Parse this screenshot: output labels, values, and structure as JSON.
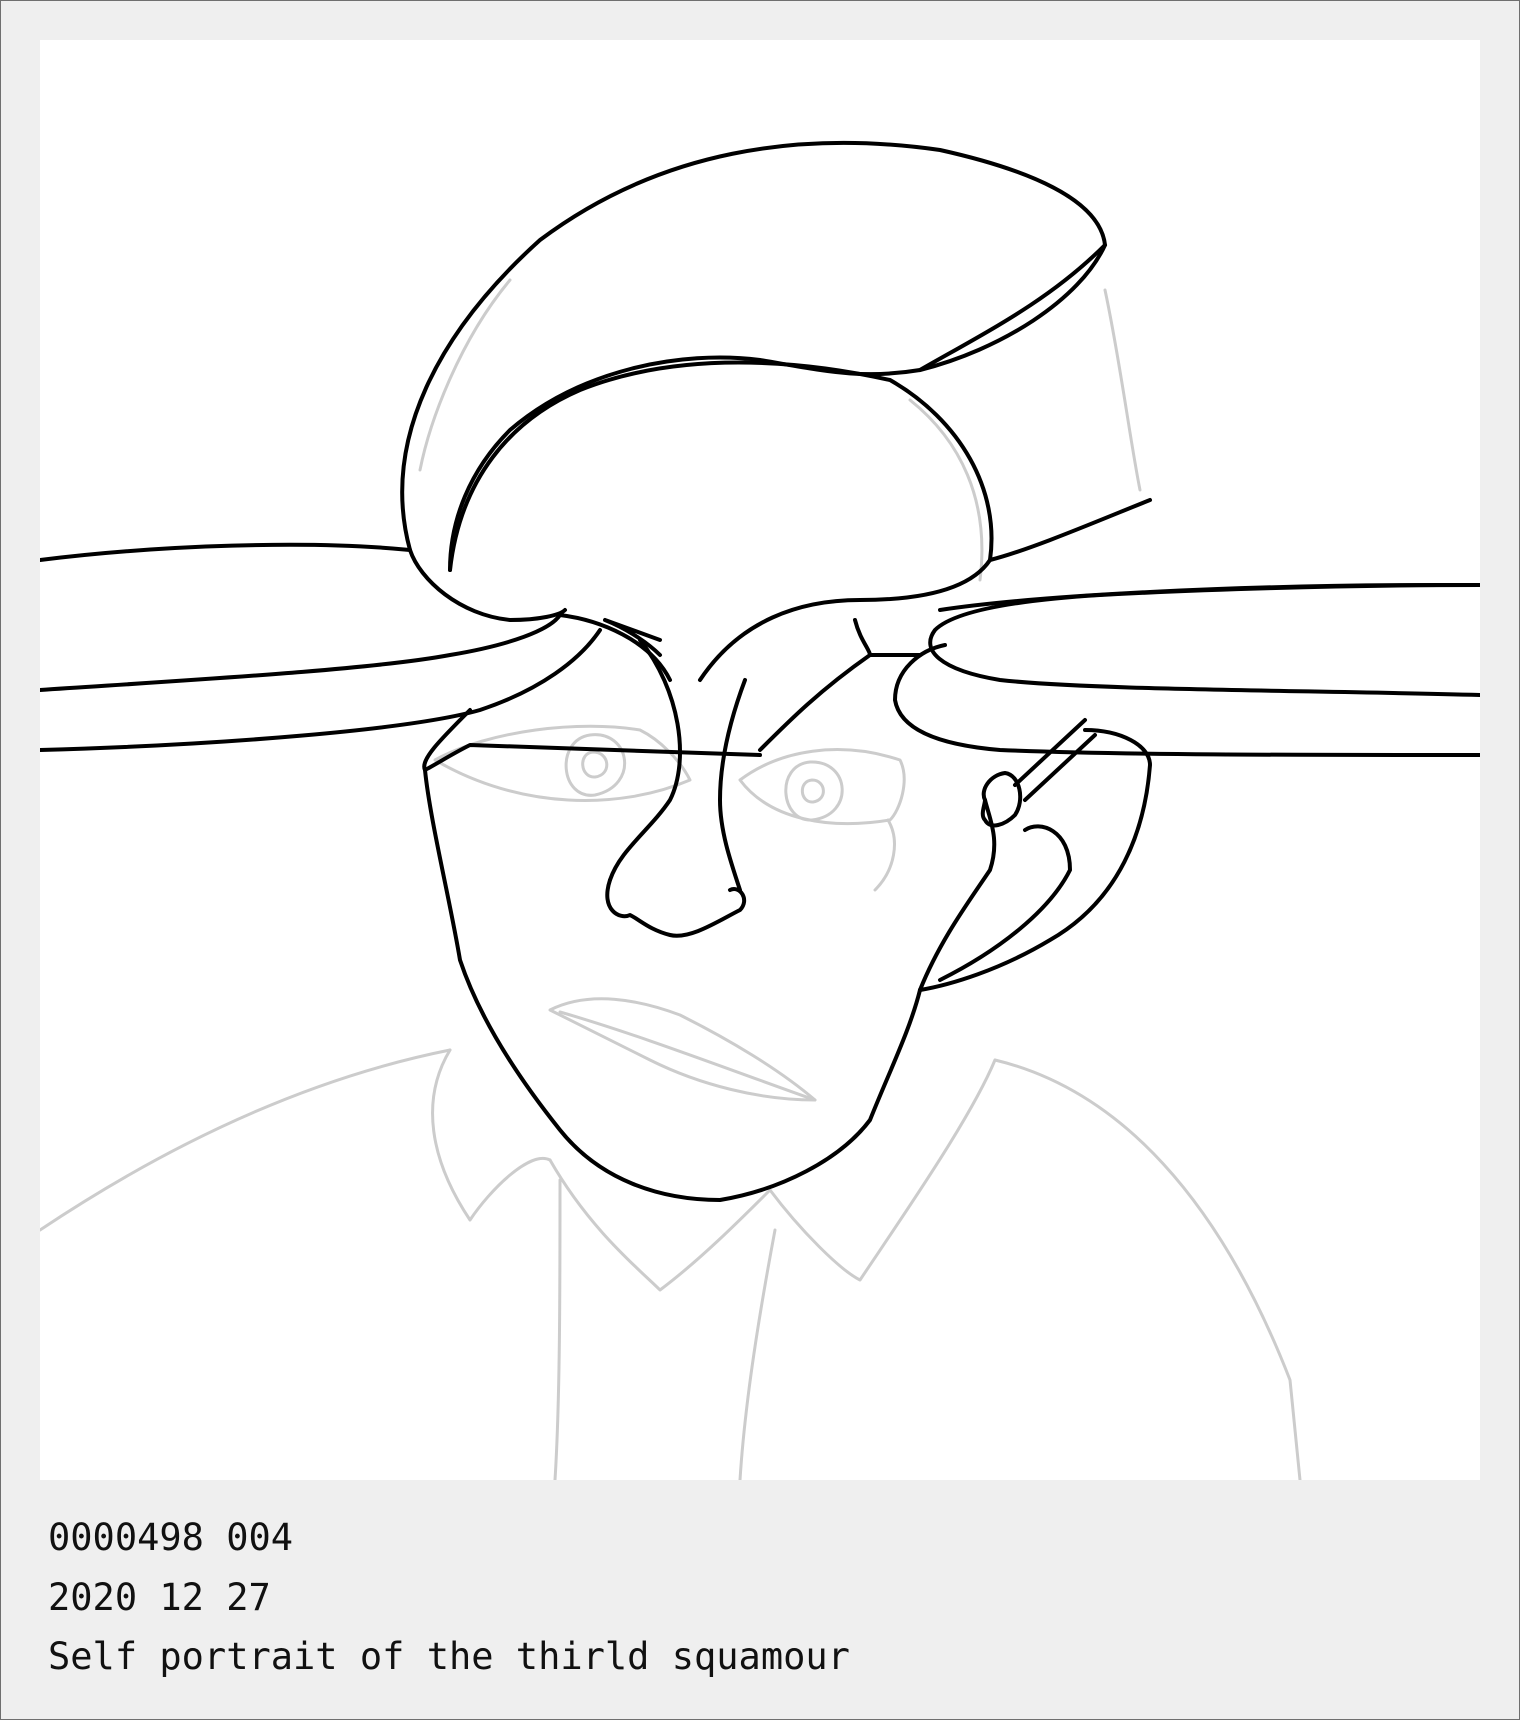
{
  "artwork": {
    "medium": "line drawing",
    "colors": {
      "frame_background": "#efefef",
      "canvas_background": "#ffffff",
      "foreground_stroke": "#000000",
      "background_stroke": "#cccccc",
      "caption_text": "#111111"
    }
  },
  "caption": {
    "id_line": "0000498 004",
    "date_line": "2020 12 27",
    "title_line": "Self portrait of the thirld squamour"
  }
}
